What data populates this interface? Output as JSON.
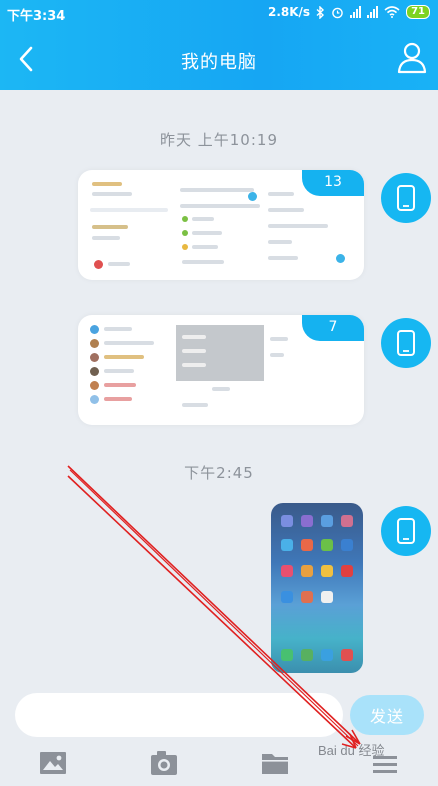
{
  "status_bar": {
    "time": "下午3:34",
    "speed": "2.8K/s",
    "battery": "71"
  },
  "nav": {
    "title": "我的电脑",
    "back_icon": "chevron-left-icon",
    "user_icon": "user-icon"
  },
  "messages": [
    {
      "timestamp": "昨天 上午10:19",
      "badge": "13",
      "type": "screenshot-document"
    },
    {
      "timestamp": "",
      "badge": "7",
      "type": "screenshot-document"
    },
    {
      "timestamp": "下午2:45",
      "type": "phone-screenshot"
    }
  ],
  "composer": {
    "input_value": "",
    "send_label": "发送"
  },
  "toolbar": {
    "items": [
      "image-icon",
      "camera-icon",
      "folder-icon",
      "more-icon"
    ]
  },
  "watermark": "Bai du 经验",
  "colors": {
    "header": "#16a6f3",
    "send": "#a9e2fa",
    "annotation": "#e02020"
  }
}
